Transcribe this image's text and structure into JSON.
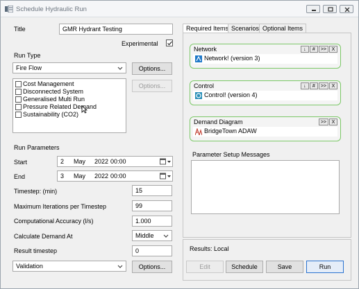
{
  "window": {
    "title": "Schedule Hydraulic Run",
    "controls": [
      "minimize-icon",
      "restore-icon",
      "close-icon"
    ]
  },
  "form": {
    "title_label": "Title",
    "title_value": "GMR Hydrant Testing",
    "experimental_label": "Experimental",
    "experimental_checked": true,
    "run_type_label": "Run Type",
    "run_type_value": "Fire Flow",
    "options_label": "Options...",
    "options2_label": "Options...",
    "options3_label": "Options...",
    "run_options": [
      {
        "label": "Cost Management",
        "checked": false
      },
      {
        "label": "Disconnected System",
        "checked": false
      },
      {
        "label": "Generalised Multi Run",
        "checked": false
      },
      {
        "label": "Pressure Related Demand",
        "checked": false
      },
      {
        "label": "Sustainability (CO2)",
        "checked": false
      }
    ],
    "run_parameters_label": "Run Parameters",
    "start_label": "Start",
    "start": {
      "day": "2",
      "month": "May",
      "year": "2022",
      "time": "00:00"
    },
    "end_label": "End",
    "end": {
      "day": "3",
      "month": "May",
      "year": "2022",
      "time": "00:00"
    },
    "timestep_label": "Timestep: (min)",
    "timestep_value": "15",
    "max_iter_label": "Maximum Iterations per Timestep",
    "max_iter_value": "99",
    "accuracy_label": "Computational Accuracy (l/s)",
    "accuracy_value": "1.000",
    "calc_demand_label": "Calculate Demand At",
    "calc_demand_value": "Middle",
    "result_timestep_label": "Result timestep",
    "result_timestep_value": "0",
    "validation_value": "Validation"
  },
  "tabs": [
    "Required Items",
    "Scenarios",
    "Optional Items"
  ],
  "required_items": {
    "network": {
      "title": "Network",
      "value": "Network! (version 3)",
      "buttons": [
        "↓",
        "#",
        ">>",
        "X"
      ]
    },
    "control": {
      "title": "Control",
      "value": "Control! (version 4)",
      "buttons": [
        "↓",
        "#",
        ">>",
        "X"
      ]
    },
    "demand_diagram": {
      "title": "Demand Diagram",
      "value": "BridgeTown ADAW",
      "buttons": [
        ">>",
        "X"
      ]
    },
    "param_messages_label": "Parameter Setup Messages"
  },
  "results": {
    "label": "Results: Local",
    "edit_label": "Edit",
    "schedule_label": "Schedule",
    "save_label": "Save",
    "run_label": "Run"
  }
}
